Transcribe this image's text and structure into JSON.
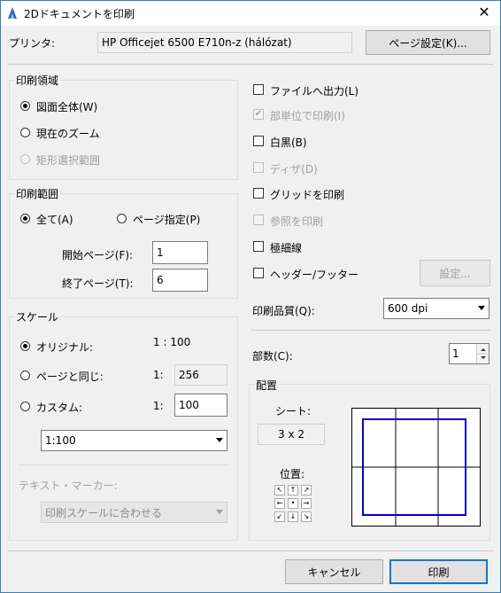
{
  "window": {
    "title": "2Dドキュメントを印刷",
    "close_label": "✕"
  },
  "printer": {
    "label": "プリンタ:",
    "name": "HP Officejet 6500 E710n-z (hálózat)",
    "page_setup_button": "ページ設定(K)..."
  },
  "print_area": {
    "title": "印刷領域",
    "options": [
      {
        "label": "図面全体(W)",
        "checked": true,
        "enabled": true
      },
      {
        "label": "現在のズーム",
        "checked": false,
        "enabled": true
      },
      {
        "label": "矩形選択範囲",
        "checked": false,
        "enabled": false
      }
    ]
  },
  "print_range": {
    "title": "印刷範囲",
    "all_label": "全て(A)",
    "pages_label": "ページ指定(P)",
    "start_label": "開始ページ(F):",
    "start_value": "1",
    "end_label": "終了ページ(T):",
    "end_value": "6"
  },
  "scale": {
    "title": "スケール",
    "original_label": "オリジナル:",
    "original_value": "1 : 100",
    "fit_page_label": "ページと同じ:",
    "fit_page_prefix": "1:",
    "fit_page_value": "256",
    "custom_label": "カスタム:",
    "custom_prefix": "1:",
    "custom_value": "100",
    "scale_select": "1:100",
    "text_marker_label": "テキスト・マーカー:",
    "text_marker_select": "印刷スケールに合わせる"
  },
  "options": {
    "print_to_file": "ファイルへ出力(L)",
    "print_by_unit": "部単位で印刷(I)",
    "black_white": "白黒(B)",
    "dither": "ディザ(D)",
    "print_grid": "グリッドを印刷",
    "print_reference": "参照を印刷",
    "thin_lines": "極細線",
    "header_footer": "ヘッダー/フッター",
    "settings_button": "設定..."
  },
  "quality": {
    "label": "印刷品質(Q):",
    "value": "600 dpi"
  },
  "copies": {
    "label": "部数(C):",
    "value": "1"
  },
  "layout": {
    "title": "配置",
    "sheets_label": "シート:",
    "sheets_value": "3 x 2",
    "position_label": "位置:",
    "position_arrows": [
      "↖",
      "↑",
      "↗",
      "←",
      "•",
      "→",
      "↙",
      "↓",
      "↘"
    ],
    "preview_frame_color": "#0000cc"
  },
  "footer": {
    "cancel_label": "キャンセル",
    "print_label": "印刷"
  }
}
